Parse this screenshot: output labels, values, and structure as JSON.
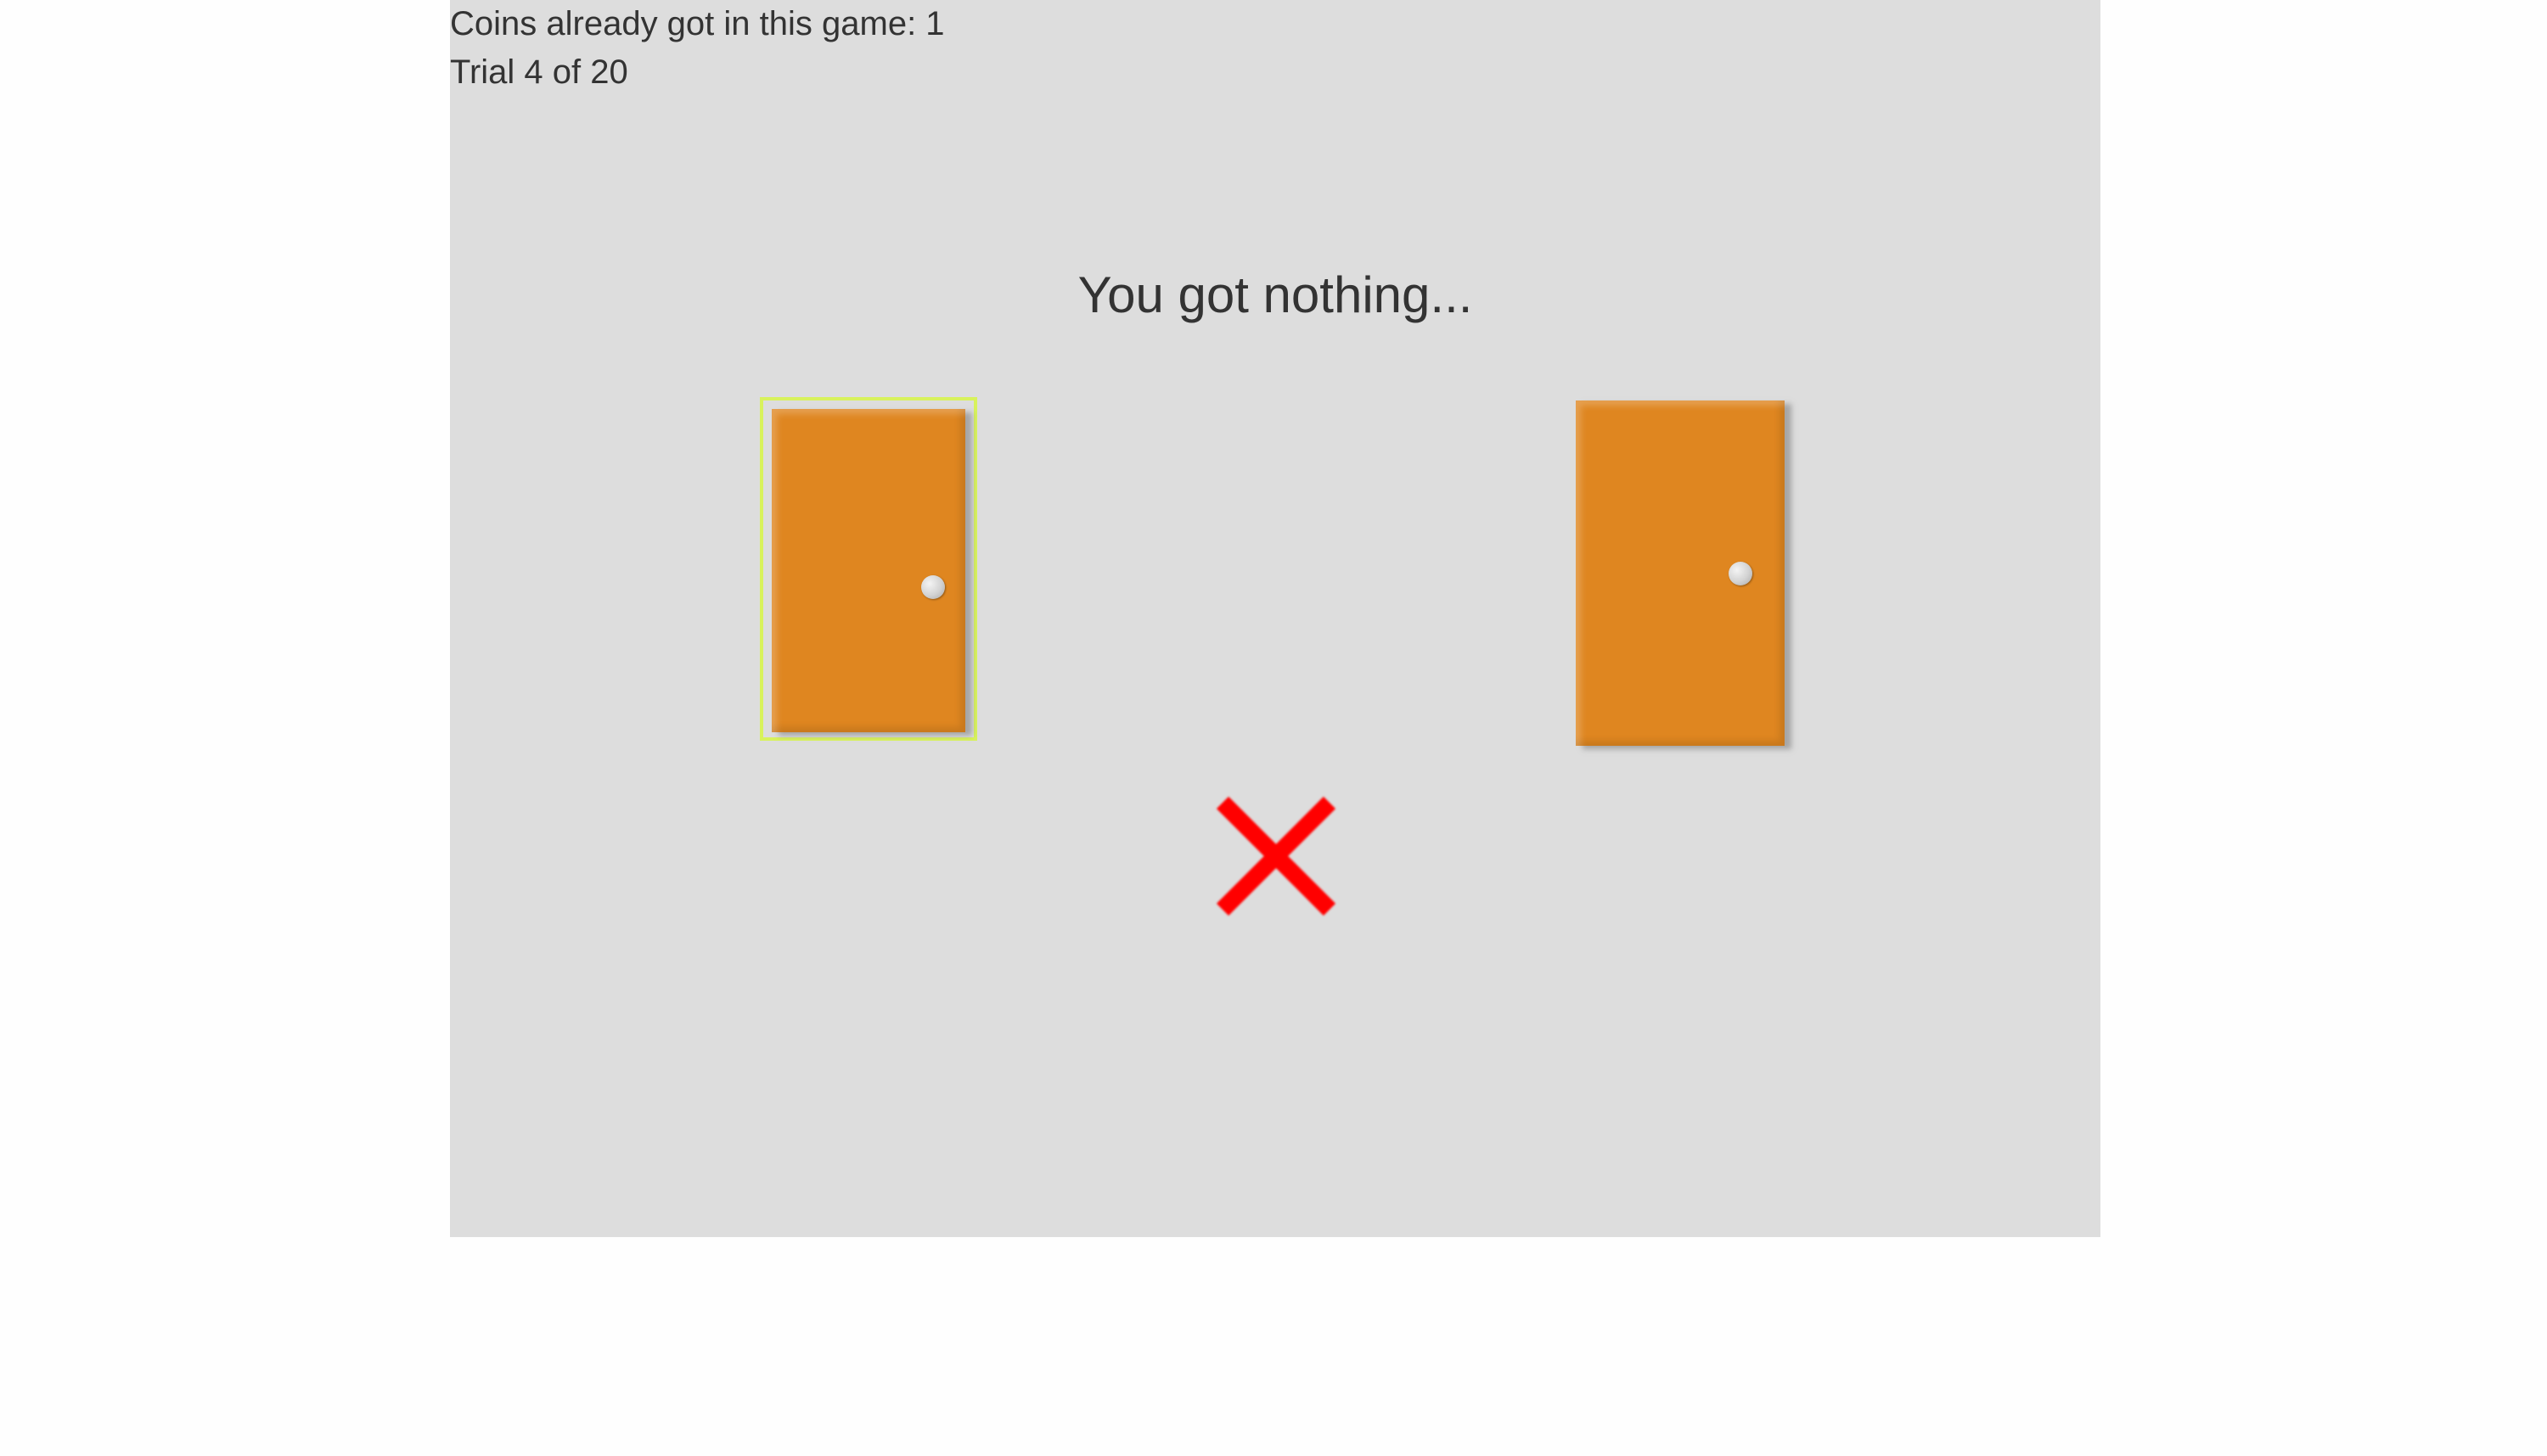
{
  "status": {
    "coins_text": "Coins already got in this game: 1",
    "trial_text": "Trial 4 of 20"
  },
  "feedback": {
    "message": "You got nothing..."
  },
  "doors": [
    {
      "label": "left-door",
      "selected": true,
      "color": "#df8620"
    },
    {
      "label": "right-door",
      "selected": false,
      "color": "#df8620"
    }
  ],
  "selection_highlight_color": "#d8f25c",
  "result_icon": {
    "name": "cross-icon",
    "color": "#ff0000"
  },
  "background_color": "#dddddd"
}
